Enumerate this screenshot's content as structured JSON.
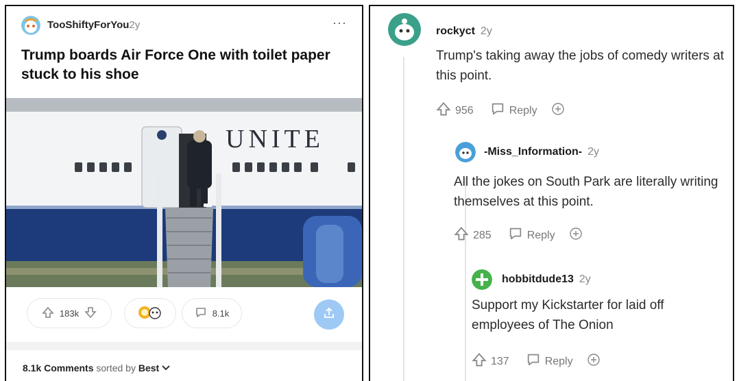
{
  "post": {
    "username": "TooShiftyForYou",
    "age": "2y",
    "more": "···",
    "title": "Trump boards Air Force One with toilet paper stuck to his shoe",
    "plane_text": "UNITE",
    "upvotes": "183k",
    "comments_count": "8.1k",
    "sort_count": "8.1k Comments",
    "sort_label": "sorted by",
    "sort_value": "Best"
  },
  "comments": [
    {
      "username": "rockyct",
      "age": "2y",
      "body": "Trump's taking away the jobs of comedy writers at this point.",
      "votes": "956",
      "reply": "Reply"
    },
    {
      "username": "-Miss_Information-",
      "age": "2y",
      "body": "All the jokes on South Park are literally writing themselves at this point.",
      "votes": "285",
      "reply": "Reply"
    },
    {
      "username": "hobbitdude13",
      "age": "2y",
      "body": "Support my Kickstarter for laid off employees of The Onion",
      "votes": "137",
      "reply": "Reply"
    }
  ],
  "icons": {
    "upvote": "arrow-up-icon",
    "downvote": "arrow-down-icon",
    "comment": "comment-bubble-icon",
    "award": "award-icon",
    "share": "share-icon",
    "chevron": "chevron-down-icon"
  },
  "colors": {
    "share_bg": "#9ec9f5",
    "avatar_teal": "#3aa08a",
    "avatar_green": "#46b24c"
  }
}
